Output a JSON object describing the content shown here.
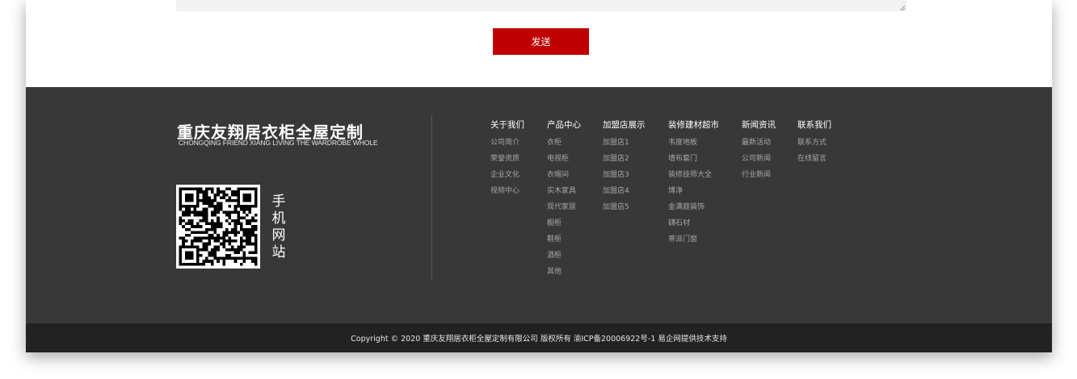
{
  "form": {
    "send_label": "发送"
  },
  "footer": {
    "brand_cn": "重庆友翔居衣柜全屋定制",
    "brand_en": "CHONGQING FRIEND XIANG LIVING THE WARDROBE WHOLE",
    "qr_label": "手机网站",
    "columns": [
      {
        "title": "关于我们",
        "items": [
          "公司简介",
          "荣誉资质",
          "企业文化",
          "视频中心"
        ]
      },
      {
        "title": "产品中心",
        "items": [
          "衣柜",
          "电视柜",
          "衣帽间",
          "实木家具",
          "现代家居",
          "橱柜",
          "鞋柜",
          "酒柜",
          "其他"
        ]
      },
      {
        "title": "加盟店展示",
        "items": [
          "加盟店1",
          "加盟店2",
          "加盟店3",
          "加盟店4",
          "加盟店5"
        ]
      },
      {
        "title": "装修建材超市",
        "items": [
          "韦度地板",
          "墙布套门",
          "装修技师大全",
          "博净",
          "金满庭装饰",
          "礴石材",
          "蒂派门窗"
        ]
      },
      {
        "title": "新闻资讯",
        "items": [
          "最新活动",
          "公司新闻",
          "行业新闻"
        ]
      },
      {
        "title": "联系我们",
        "items": [
          "联系方式",
          "在线留言"
        ]
      }
    ],
    "copyright": "Copyright © 2020 重庆友翔居衣柜全屋定制有限公司 版权所有 渝ICP备20006922号-1 易企网提供技术支持"
  },
  "colors": {
    "accent": "#c00000",
    "footer_bg": "#383838",
    "copyright_bg": "#222222"
  },
  "icons": [
    "qr-code-icon",
    "resize-handle-icon"
  ]
}
